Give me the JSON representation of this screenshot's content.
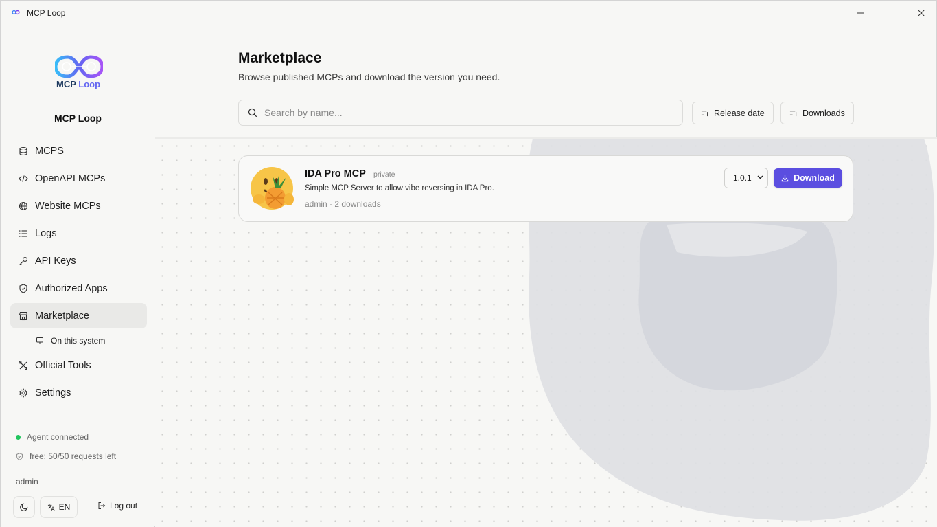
{
  "window": {
    "title": "MCP Loop",
    "controls": {
      "minimize": "minimize-icon",
      "maximize": "maximize-icon",
      "close": "close-icon"
    }
  },
  "sidebar": {
    "logo_text_main": "MCP",
    "logo_text_accent": "Loop",
    "brand": "MCP Loop",
    "items": [
      {
        "label": "MCPS",
        "icon": "database-icon"
      },
      {
        "label": "OpenAPI MCPs",
        "icon": "code-icon"
      },
      {
        "label": "Website MCPs",
        "icon": "globe-icon"
      },
      {
        "label": "Logs",
        "icon": "list-icon"
      },
      {
        "label": "API Keys",
        "icon": "key-icon"
      },
      {
        "label": "Authorized Apps",
        "icon": "shield-icon"
      },
      {
        "label": "Marketplace",
        "icon": "store-icon",
        "active": true
      },
      {
        "label": "Official Tools",
        "icon": "tools-icon"
      },
      {
        "label": "Settings",
        "icon": "gear-icon"
      }
    ],
    "sub_item": {
      "label": "On this system",
      "icon": "monitor-icon"
    },
    "agent_status": "Agent connected",
    "quota": "free: 50/50 requests left",
    "user": "admin",
    "lang": "EN",
    "logout": "Log out"
  },
  "main": {
    "title": "Marketplace",
    "subtitle": "Browse published MCPs and download the version you need.",
    "search_placeholder": "Search by name...",
    "sort_release": "Release date",
    "sort_downloads": "Downloads",
    "cards": [
      {
        "name": "IDA Pro MCP",
        "badge": "private",
        "description": "Simple MCP Server to allow vibe reversing in IDA Pro.",
        "meta": "admin · 2 downloads",
        "version": "1.0.1",
        "download_label": "Download"
      }
    ]
  },
  "colors": {
    "accent": "#5b4ee0",
    "status_ok": "#22c55e",
    "active_nav": "#e9e9e7"
  }
}
